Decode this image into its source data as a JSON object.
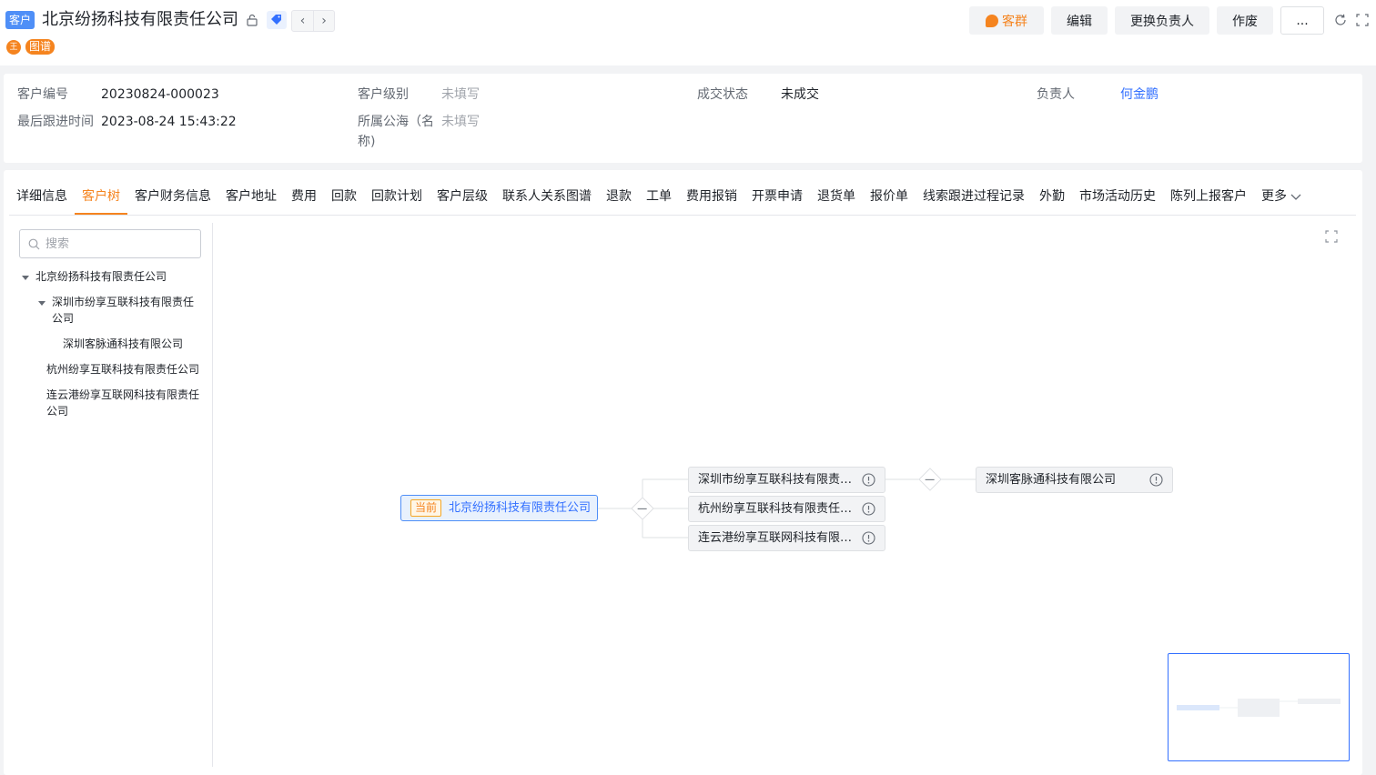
{
  "header": {
    "type_badge": "客户",
    "title": "北京纷扬科技有限责任公司",
    "user_initial": "王",
    "map_tag": "图谱",
    "buttons": {
      "group": "客群",
      "edit": "编辑",
      "change_owner": "更换负责人",
      "void": "作废",
      "more": "..."
    }
  },
  "info": {
    "customer_no_label": "客户编号",
    "customer_no": "20230824-000023",
    "level_label": "客户级别",
    "level": "未填写",
    "deal_status_label": "成交状态",
    "deal_status": "未成交",
    "owner_label": "负责人",
    "owner": "何金鹏",
    "last_follow_label": "最后跟进时间",
    "last_follow": "2023-08-24 15:43:22",
    "pool_label_1": "所属公海（名",
    "pool_label_2": "称)",
    "pool": "未填写"
  },
  "tabs": [
    "详细信息",
    "客户树",
    "客户财务信息",
    "客户地址",
    "费用",
    "回款",
    "回款计划",
    "客户层级",
    "联系人关系图谱",
    "退款",
    "工单",
    "费用报销",
    "开票申请",
    "退货单",
    "报价单",
    "线索跟进过程记录",
    "外勤",
    "市场活动历史",
    "陈列上报客户",
    "更多"
  ],
  "active_tab": "客户树",
  "tree": {
    "search_placeholder": "搜索",
    "nodes": {
      "root": "北京纷扬科技有限责任公司",
      "shenzhen_1": "深圳市纷享互联科技有限责任",
      "shenzhen_2": "公司",
      "kemaitong": "深圳客脉通科技有限公司",
      "hangzhou": "杭州纷享互联科技有限责任公司",
      "lianyungang_1": "连云港纷享互联网科技有限责任",
      "lianyungang_2": "公司"
    }
  },
  "graph": {
    "current_tag": "当前",
    "current": "北京纷扬科技有限责任公司",
    "child_1": "深圳市纷享互联科技有限责任公司",
    "child_2": "杭州纷享互联科技有限责任公司",
    "child_3": "连云港纷享互联网科技有限责任公司",
    "grandchild_1": "深圳客脉通科技有限公司"
  }
}
